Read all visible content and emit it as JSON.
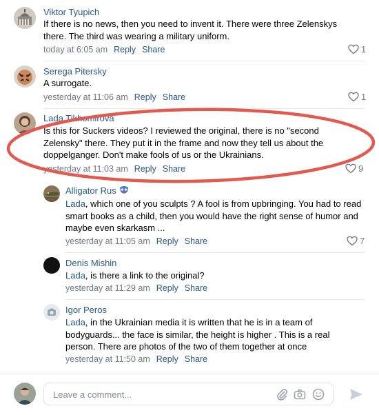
{
  "comments": [
    {
      "author": "Viktor Tyupich",
      "text": "If there is no news, then you need to invent it. There were three Zelenskys there. The third was wearing a military uniform.",
      "time": "today at 6:05 am",
      "reply": "Reply",
      "share": "Share",
      "likes": "1"
    },
    {
      "author": "Serega Pitersky",
      "text": "A surrogate.",
      "time": "yesterday at 11:06 am",
      "reply": "Reply",
      "share": "Share",
      "likes": "1"
    },
    {
      "author": "Lada Tikhomirova",
      "text": "Is this for Suckers videos? I reviewed the original, there is no \"second Zelensky\" there. They put it in the frame and now they tell us about the doppelganger. Don't make fools of us or the Ukrainians.",
      "time": "yesterday at 11:03 am",
      "reply": "Reply",
      "share": "Share",
      "likes": "9"
    }
  ],
  "replies": [
    {
      "author": "Alligator Rus",
      "mention": "Lada",
      "text": ", which one of you sculpts ? A fool is from upbringing. You had to read smart books as a child, then you would have the right sense of humor and maybe even skarkasm ...",
      "time": "yesterday at 11:05 am",
      "reply": "Reply",
      "share": "Share",
      "likes": "7"
    },
    {
      "author": "Denis Mishin",
      "mention": "Lada",
      "text": ", is there a link to the original?",
      "time": "yesterday at 11:29 am",
      "reply": "Reply",
      "share": "Share"
    },
    {
      "author": "Igor Peros",
      "mention": "Lada",
      "text": ", in the Ukrainian media it is written that he is in a team of bodyguards... the face is similar, the height is higher . This is a real person. There are photos of the two of them together at once",
      "time": "yesterday at 11:50 am",
      "reply": "Reply",
      "share": "Share"
    }
  ],
  "composer": {
    "placeholder": "Leave a comment..."
  },
  "icons": {
    "like": "heart-outline-icon",
    "attach": "paperclip-icon",
    "camera": "camera-icon",
    "emoji": "smiley-icon",
    "send": "send-arrow-icon",
    "badge": "mask-badge-icon"
  },
  "colors": {
    "link": "#2a5885",
    "meta": "#6f7985",
    "highlight_ellipse": "#e05a50"
  }
}
